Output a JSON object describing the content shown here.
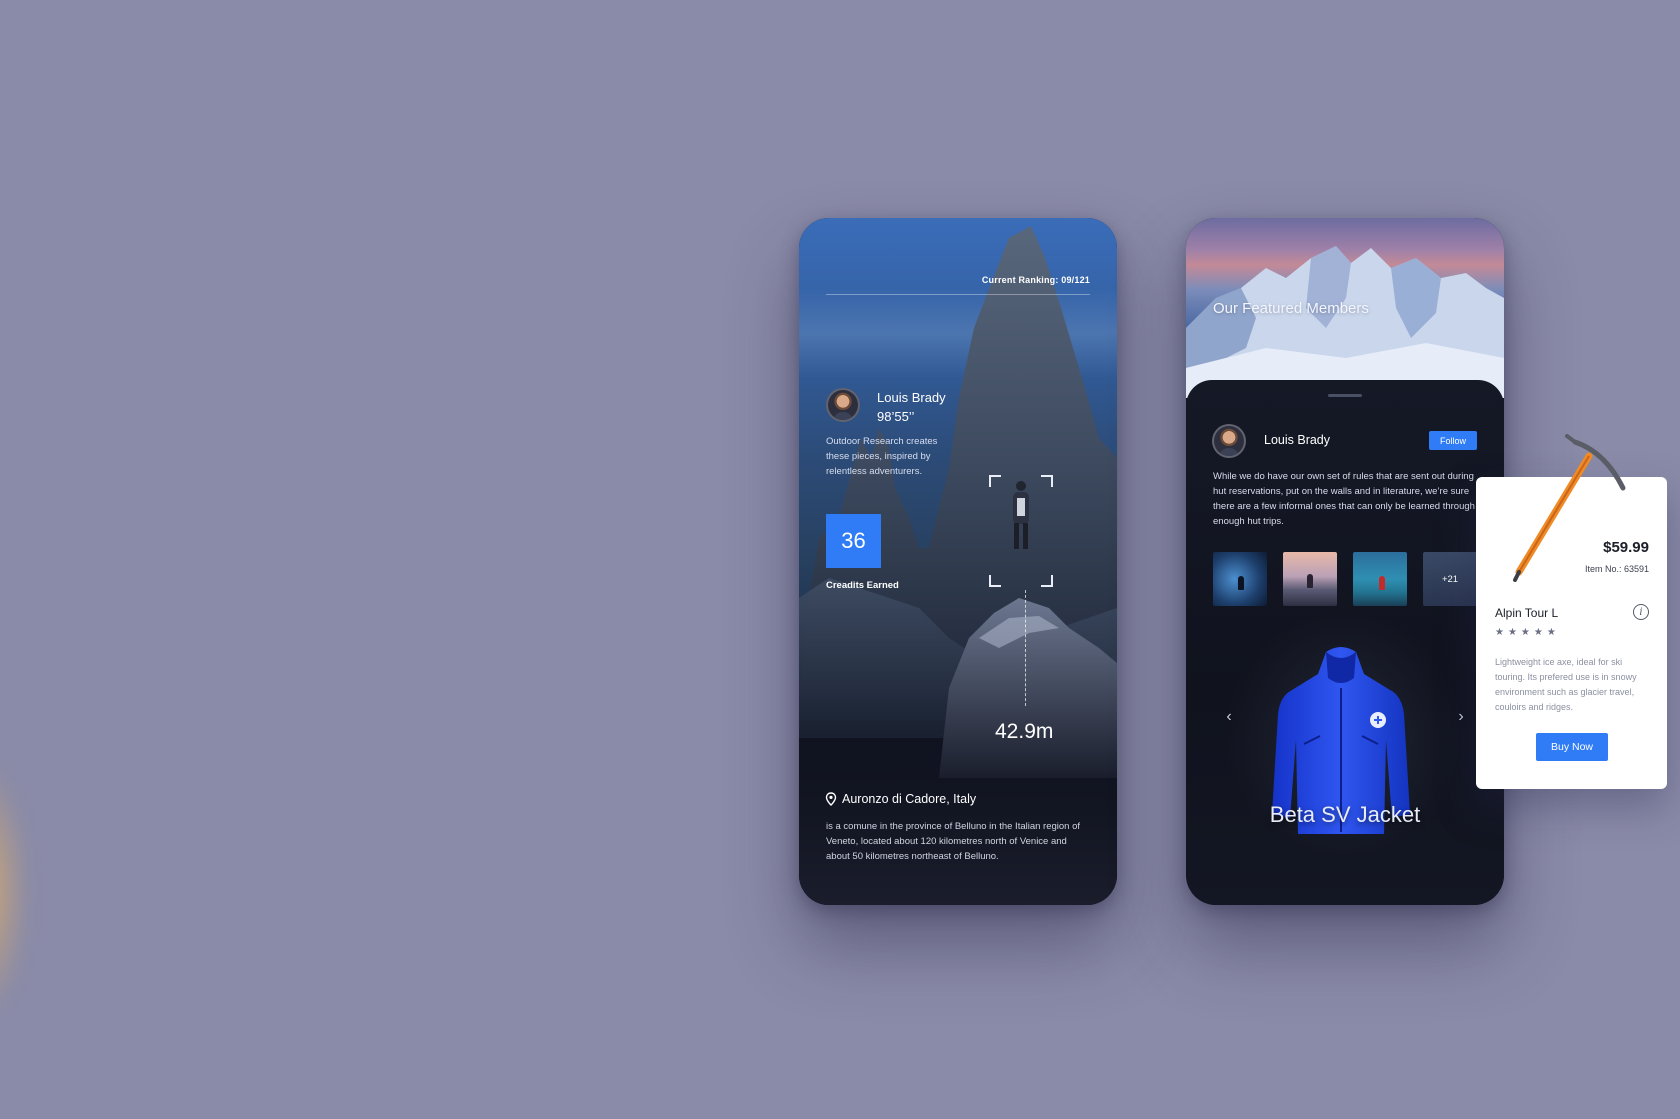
{
  "background": {
    "color": "#8a8ba8"
  },
  "accent_color": "#2f7cf6",
  "phone1": {
    "ranking": "Current Ranking: 09/121",
    "member": {
      "name": "Louis Brady",
      "time": "98’55’’"
    },
    "description": "Outdoor Research creates these pieces, inspired by relentless adventurers.",
    "credits": {
      "value": "36",
      "label": "Creadits Earned"
    },
    "distance": "42.9m",
    "location": {
      "icon": "location-pin-icon",
      "name": "Auronzo di Cadore, Italy",
      "description": "is a comune in the province of Belluno in the Italian region of Veneto, located about 120 kilometres north of Venice and about 50 kilometres northeast of Belluno."
    }
  },
  "phone2": {
    "title": "Our Featured Members",
    "member": {
      "name": "Louis Brady"
    },
    "follow_label": "Follow",
    "description": "While we do have our own set of rules that are sent out during hut reservations, put on the walls and in literature, we’re sure there are a few informal ones that can only be learned through enough hut trips.",
    "gallery_more": "+21",
    "product": {
      "name": "Beta SV Jacket"
    },
    "nav": {
      "prev_icon": "chevron-left-icon",
      "next_icon": "chevron-right-icon"
    }
  },
  "product_card": {
    "price": "$59.99",
    "item_no": "Item No.: 63591",
    "name": "Alpin Tour L",
    "rating": {
      "value": 5,
      "max": 5,
      "stars": "★★★★★"
    },
    "description": "Lightweight ice axe, ideal for ski touring. Its prefered use is in snowy environment such as glacier travel, couloirs and ridges.",
    "buy_label": "Buy Now",
    "info_icon": "info-icon"
  }
}
